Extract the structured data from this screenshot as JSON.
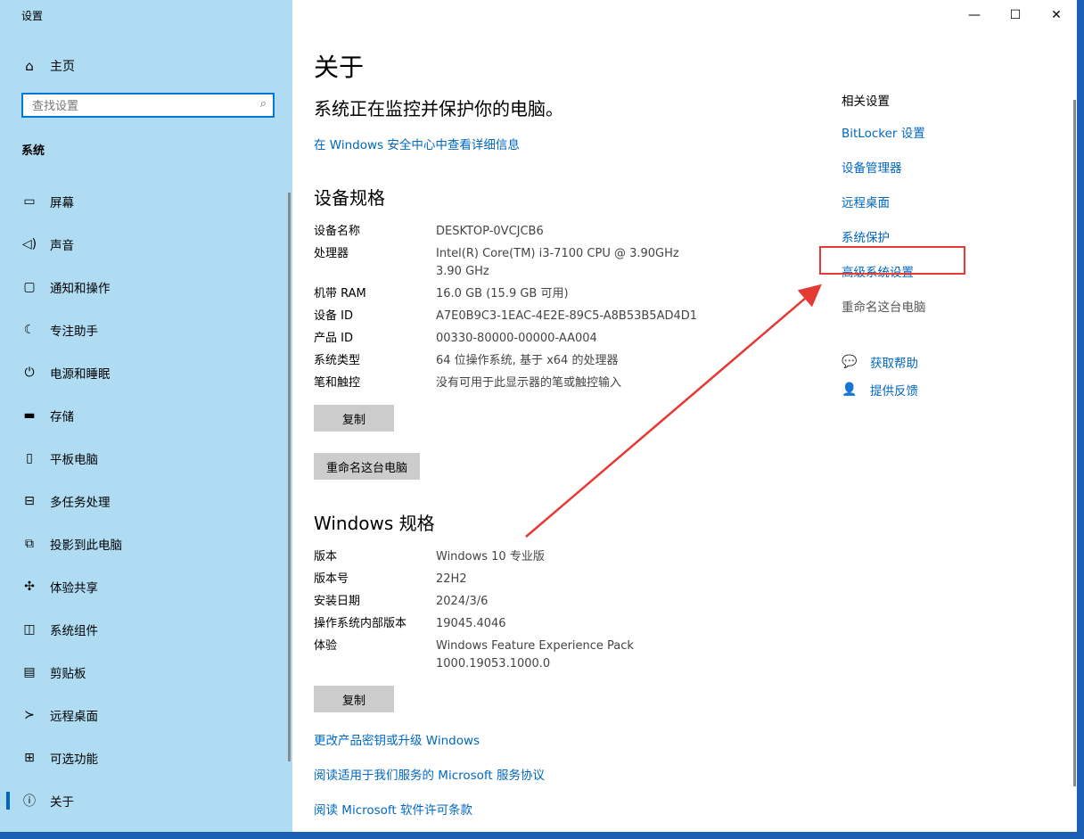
{
  "window": {
    "app_title": "设置"
  },
  "sidebar": {
    "home_label": "主页",
    "search_placeholder": "查找设置",
    "group_label": "系统",
    "items": [
      {
        "label": "屏幕",
        "icon": "monitor-icon"
      },
      {
        "label": "声音",
        "icon": "speaker-icon"
      },
      {
        "label": "通知和操作",
        "icon": "notification-icon"
      },
      {
        "label": "专注助手",
        "icon": "moon-icon"
      },
      {
        "label": "电源和睡眠",
        "icon": "power-icon"
      },
      {
        "label": "存储",
        "icon": "storage-icon"
      },
      {
        "label": "平板电脑",
        "icon": "tablet-icon"
      },
      {
        "label": "多任务处理",
        "icon": "multitask-icon"
      },
      {
        "label": "投影到此电脑",
        "icon": "project-icon"
      },
      {
        "label": "体验共享",
        "icon": "share-icon"
      },
      {
        "label": "系统组件",
        "icon": "components-icon"
      },
      {
        "label": "剪贴板",
        "icon": "clipboard-icon"
      },
      {
        "label": "远程桌面",
        "icon": "remote-desktop-icon"
      },
      {
        "label": "可选功能",
        "icon": "optional-features-icon"
      },
      {
        "label": "关于",
        "icon": "info-icon",
        "active": true
      }
    ]
  },
  "main": {
    "title": "关于",
    "protect_text": "系统正在监控并保护你的电脑。",
    "security_link": "在 Windows 安全中心中查看详细信息",
    "device_specs": {
      "title": "设备规格",
      "rows": [
        {
          "key": "设备名称",
          "value": "DESKTOP-0VCJCB6"
        },
        {
          "key": "处理器",
          "value": "Intel(R) Core(TM) i3-7100 CPU @ 3.90GHz   3.90 GHz"
        },
        {
          "key": "机带 RAM",
          "value": "16.0 GB (15.9 GB 可用)"
        },
        {
          "key": "设备 ID",
          "value": "A7E0B9C3-1EAC-4E2E-89C5-A8B53B5AD4D1"
        },
        {
          "key": "产品 ID",
          "value": "00330-80000-00000-AA004"
        },
        {
          "key": "系统类型",
          "value": "64 位操作系统, 基于 x64 的处理器"
        },
        {
          "key": "笔和触控",
          "value": "没有可用于此显示器的笔或触控输入"
        }
      ],
      "copy_label": "复制",
      "rename_label": "重命名这台电脑"
    },
    "windows_specs": {
      "title": "Windows 规格",
      "rows": [
        {
          "key": "版本",
          "value": "Windows 10 专业版"
        },
        {
          "key": "版本号",
          "value": "22H2"
        },
        {
          "key": "安装日期",
          "value": "2024/3/6"
        },
        {
          "key": "操作系统内部版本",
          "value": "19045.4046"
        },
        {
          "key": "体验",
          "value": "Windows Feature Experience Pack 1000.19053.1000.0"
        }
      ],
      "copy_label": "复制"
    },
    "links": {
      "product_key": "更改产品密钥或升级 Windows",
      "service_agreement": "阅读适用于我们服务的 Microsoft 服务协议",
      "license_terms": "阅读 Microsoft 软件许可条款"
    }
  },
  "related": {
    "title": "相关设置",
    "items": [
      {
        "label": "BitLocker 设置"
      },
      {
        "label": "设备管理器"
      },
      {
        "label": "远程桌面"
      },
      {
        "label": "系统保护"
      },
      {
        "label": "高级系统设置",
        "highlighted": true
      },
      {
        "label": "重命名这台电脑",
        "disabled": true
      }
    ],
    "help": [
      {
        "label": "获取帮助",
        "icon": "help-chat-icon"
      },
      {
        "label": "提供反馈",
        "icon": "feedback-icon"
      }
    ]
  },
  "colors": {
    "accent": "#0067c0",
    "sidebar_bg": "#afdcf3",
    "annotation": "#e53935"
  }
}
